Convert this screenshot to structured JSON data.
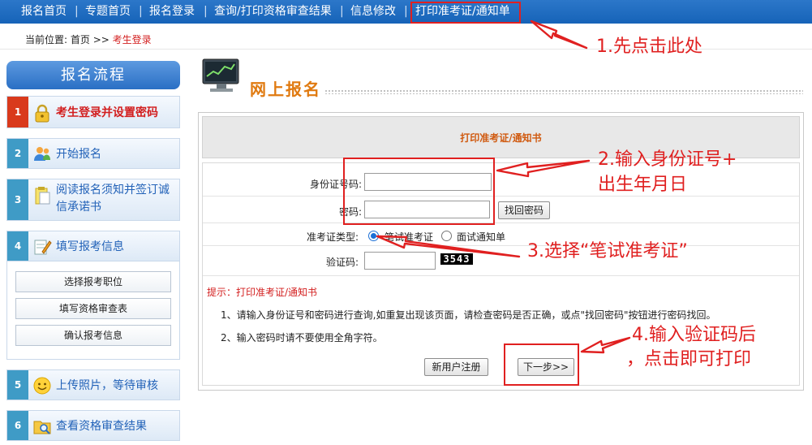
{
  "nav": {
    "items": [
      "报名首页",
      "专题首页",
      "报名登录",
      "查询/打印资格审查结果",
      "信息修改",
      "打印准考证/通知单"
    ],
    "separator": "|"
  },
  "breadcrumb": {
    "prefix": "当前位置:",
    "home": "首页",
    "arrow": ">>",
    "current": "考生登录"
  },
  "sidebar": {
    "title": "报名流程",
    "steps": [
      {
        "num": "1",
        "label": "考生登录并设置密码",
        "icon": "lock-icon"
      },
      {
        "num": "2",
        "label": "开始报名",
        "icon": "users-icon"
      },
      {
        "num": "3",
        "label_line1": "阅读报名须知并签订诚",
        "label_line2": "信承诺书",
        "icon": "clipboard-icon"
      },
      {
        "num": "4",
        "label": "填写报考信息",
        "icon": "pencil-note-icon"
      },
      {
        "num": "5",
        "label": "上传照片，等待审核",
        "icon": "smiley-icon"
      },
      {
        "num": "6",
        "label": "查看资格审查结果",
        "icon": "folder-search-icon"
      }
    ],
    "substeps": [
      "选择报考职位",
      "填写资格审查表",
      "确认报考信息"
    ]
  },
  "main": {
    "title": "网上报名",
    "panel_title": "打印准考证/通知书",
    "form": {
      "id_label": "身份证号码:",
      "id_value": "",
      "password_label": "密码:",
      "password_value": "",
      "retrieve_button": "找回密码",
      "ticket_type_label": "准考证类型:",
      "option_written": "笔试准考证",
      "option_interview": "面试通知单",
      "selected_option": "笔试准考证",
      "captcha_label": "验证码:",
      "captcha_value": "",
      "captcha_code": "3543",
      "hint_title": "提示：打印准考证/通知书",
      "hint1": "1、请输入身份证号和密码进行查询,如重复出现该页面，请检查密码是否正确，或点\"找回密码\"按钮进行密码找回。",
      "hint2": "2、输入密码时请不要使用全角字符。",
      "register_button": "新用户注册",
      "next_button": "下一步>>"
    }
  },
  "annotations": {
    "a1": "1.先点击此处",
    "a2_line1": "2.输入身份证号+",
    "a2_line2": "出生年月日",
    "a3": "3.选择“笔试准考证”",
    "a4_line1": "4.输入验证码后",
    "a4_line2": "，点击即可打印"
  },
  "colors": {
    "nav_bg": "#1663b8",
    "annotation_red": "#e02020",
    "active_step": "#d93a1c",
    "step_num": "#3f9bc6",
    "title_orange": "#e07a10"
  }
}
